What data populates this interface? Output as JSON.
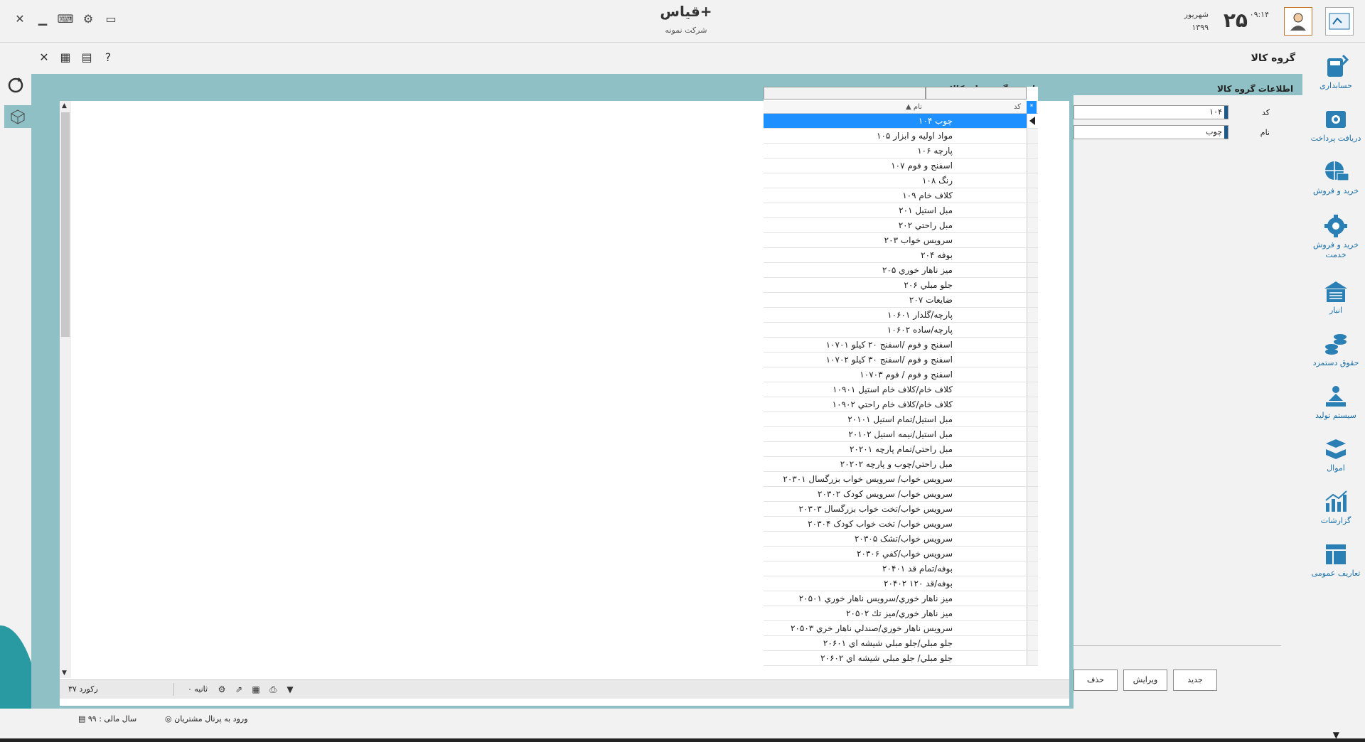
{
  "app": {
    "title": "قیاس+",
    "company": "شرکت نمونه"
  },
  "date": {
    "day": "۲۵",
    "month": "شهریور",
    "year": "۱۳۹۹",
    "time": "۰۹:۱۴"
  },
  "page": {
    "title": "گروه کالا"
  },
  "sidebar": {
    "items": [
      {
        "label": "حسابداری",
        "icon": "accounting-icon"
      },
      {
        "label": "دریافت پرداخت",
        "icon": "payment-icon"
      },
      {
        "label": "خرید و فروش",
        "icon": "buy-sell-icon"
      },
      {
        "label": "خرید و فروش خدمت",
        "icon": "service-gear-icon"
      },
      {
        "label": "انبار",
        "icon": "warehouse-icon"
      },
      {
        "label": "حقوق دستمزد",
        "icon": "payroll-icon"
      },
      {
        "label": "سیستم تولید",
        "icon": "production-icon"
      },
      {
        "label": "اموال",
        "icon": "assets-icon"
      },
      {
        "label": "گزارشات",
        "icon": "reports-icon"
      },
      {
        "label": "تعاریف عمومی",
        "icon": "definitions-icon"
      }
    ]
  },
  "panel": {
    "list_label": "لیست گروه های کالا",
    "info_label": "اطلاعات گروه کالا"
  },
  "grid": {
    "col_name": "نام",
    "col_code": "کد",
    "star": "*",
    "rows": [
      "۱۰۴ چوب",
      "۱۰۵ مواد اولیه و ابزار",
      "۱۰۶ پارچه",
      "۱۰۷ اسفنج و فوم",
      "۱۰۸ رنگ",
      "۱۰۹ کلاف خام",
      "۲۰۱ مبل استیل",
      "۲۰۲ مبل راحتي",
      "۲۰۳ سرویس خواب",
      "۲۰۴ بوفه",
      "۲۰۵ میز ناهار خوري",
      "۲۰۶ جلو مبلي",
      "۲۰۷ ضایعات",
      "۱۰۶۰۱ پارچه/گلدار",
      "۱۰۶۰۲ پارچه/ساده",
      "۱۰۷۰۱ اسفنج و فوم /اسفنج ۲۰ کیلو",
      "۱۰۷۰۲ اسفنج و فوم /اسفنج ۳۰ کیلو",
      "۱۰۷۰۳ اسفنج و فوم / فوم",
      "۱۰۹۰۱ کلاف خام/کلاف خام استیل",
      "۱۰۹۰۲ کلاف خام/کلاف خام راحتي",
      "۲۰۱۰۱ مبل استیل/تمام استیل",
      "۲۰۱۰۲ مبل استیل/نیمه استیل",
      "۲۰۲۰۱ مبل راحتي/تمام پارچه",
      "۲۰۲۰۲ مبل راحتي/چوب و پارچه",
      "۲۰۳۰۱ سرویس خواب/ سرویس خواب بزرگسال",
      "۲۰۳۰۲ سرویس خواب/ سرویس کودک",
      "۲۰۳۰۳ سرویس خواب/تخت خواب بزرگسال",
      "۲۰۳۰۴ سرویس خواب/ تخت خواب کودک",
      "۲۰۳۰۵ سرویس خواب/تشک",
      "۲۰۳۰۶ سرویس خواب/کفي",
      "۲۰۴۰۱ بوفه/تمام قد",
      "۲۰۴۰۲ بوفه/قد ۱۲۰",
      "۲۰۵۰۱ میز ناهار خوري/سرویس ناهار خوري",
      "۲۰۵۰۲ میز ناهار خوري/میز تك",
      "۲۰۵۰۳ سرویس ناهار خوري/صندلي ناهار خري",
      "۲۰۶۰۱ جلو مبلي/جلو مبلي شیشه اي",
      "۲۰۶۰۲ جلو مبلي/ جلو مبلي شیشه اي"
    ],
    "selected_index": 0
  },
  "form": {
    "code_label": "کد",
    "code_value": "۱۰۴",
    "name_label": "نام",
    "name_value": "چوب",
    "btn_new": "جدید",
    "btn_edit": "ویرایش",
    "btn_delete": "حذف"
  },
  "status": {
    "records": "۳۷ رکورد",
    "time": "۰ ثانیه"
  },
  "footer": {
    "fiscal_year": "سال مالی : ۹۹",
    "portal": "ورود به پرتال مشتریان"
  },
  "colors": {
    "teal": "#8fc0c5",
    "selected": "#1e90ff",
    "link": "#1a6fa8"
  }
}
